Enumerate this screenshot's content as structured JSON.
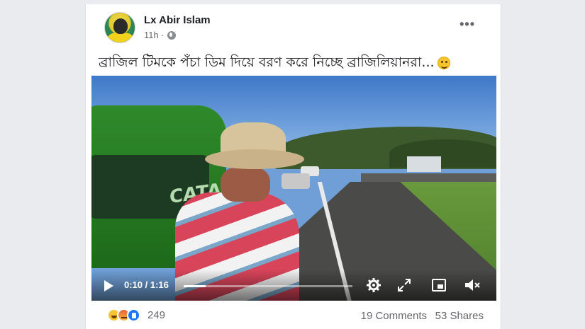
{
  "post": {
    "author": "Lx Abir Islam",
    "time": "11h",
    "privacy_icon": "globe-icon",
    "more_label": "•••",
    "text": "ব্রাজিল টিমকে পঁচা ডিম দিয়ে বরণ করে নিচ্ছে ব্রাজিলিয়ানরা...",
    "emoji_icon": "grinning-face-icon"
  },
  "video": {
    "bus_lettering": "CATA",
    "current_time": "0:10",
    "duration": "1:16",
    "time_display": "0:10 / 1:16",
    "progress_fraction": 0.13
  },
  "footer": {
    "reaction_icons": [
      "haha-icon",
      "angry-icon",
      "like-icon"
    ],
    "reaction_count": "249",
    "comments": "19 Comments",
    "shares": "53 Shares"
  },
  "colors": {
    "page_bg": "#e9ebee",
    "card_bg": "#ffffff",
    "text_primary": "#1c1e21",
    "text_secondary": "#65676b",
    "like_blue": "#1877f2"
  }
}
